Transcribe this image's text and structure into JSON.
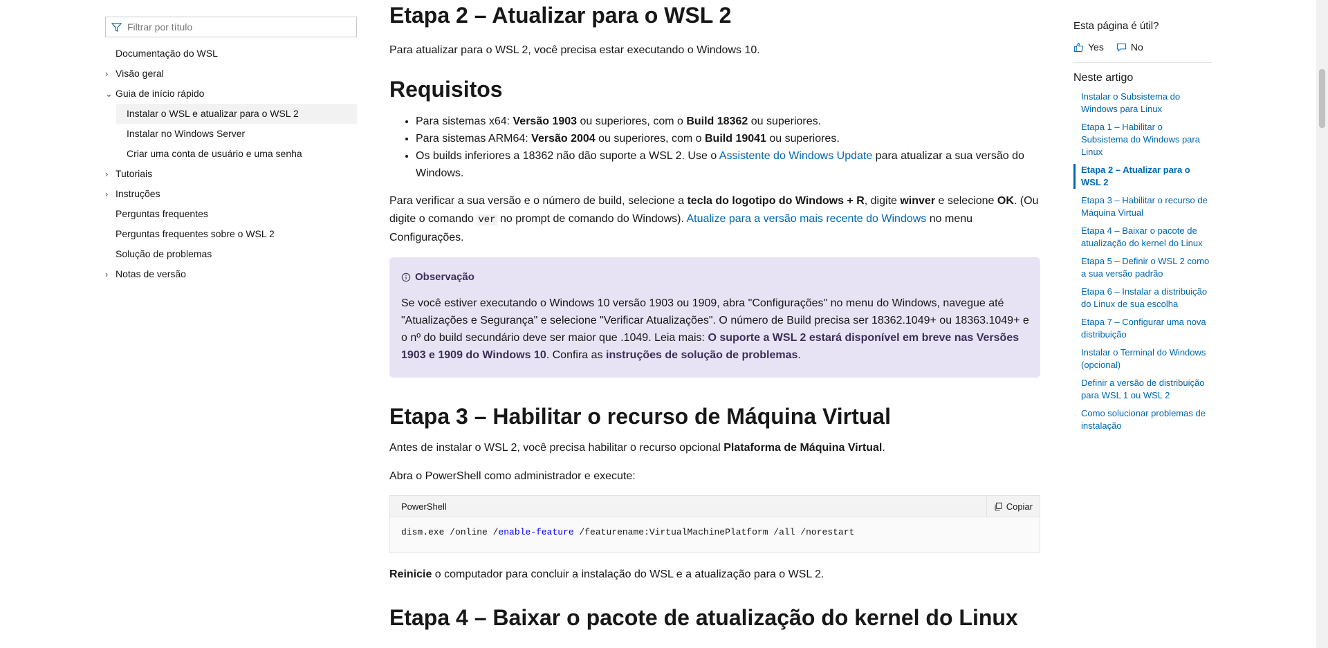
{
  "sidebar": {
    "filter_placeholder": "Filtrar por título",
    "items": [
      {
        "label": "Documentação do WSL",
        "chevron": ""
      },
      {
        "label": "Visão geral",
        "chevron": ">"
      },
      {
        "label": "Guia de início rápido",
        "chevron": "v"
      },
      {
        "label": "Instalar o WSL e atualizar para o WSL 2"
      },
      {
        "label": "Instalar no Windows Server"
      },
      {
        "label": "Criar uma conta de usuário e uma senha"
      },
      {
        "label": "Tutoriais",
        "chevron": ">"
      },
      {
        "label": "Instruções",
        "chevron": ">"
      },
      {
        "label": "Perguntas frequentes",
        "chevron": ""
      },
      {
        "label": "Perguntas frequentes sobre o WSL 2",
        "chevron": ""
      },
      {
        "label": "Solução de problemas",
        "chevron": ""
      },
      {
        "label": "Notas de versão",
        "chevron": ">"
      }
    ]
  },
  "main": {
    "step2_title": "Etapa 2 – Atualizar para o WSL 2",
    "step2_intro": "Para atualizar para o WSL 2, você precisa estar executando o Windows 10.",
    "req_title": "Requisitos",
    "req": {
      "x64_a": "Para sistemas x64: ",
      "x64_b": "Versão 1903",
      "x64_c": " ou superiores, com o ",
      "x64_d": "Build 18362",
      "x64_e": " ou superiores.",
      "arm_a": "Para sistemas ARM64: ",
      "arm_b": "Versão 2004",
      "arm_c": " ou superiores, com o ",
      "arm_d": "Build 19041",
      "arm_e": " ou superiores.",
      "builds_a": "Os builds inferiores a 18362 não dão suporte a WSL 2. Use o ",
      "builds_link": "Assistente do Windows Update",
      "builds_b": " para atualizar a sua versão do Windows."
    },
    "verify": {
      "a": "Para verificar a sua versão e o número de build, selecione a ",
      "b": "tecla do logotipo do Windows + R",
      "c": ", digite ",
      "d": "winver",
      "e": " e selecione ",
      "f": "OK",
      "g": ". (Ou digite o comando ",
      "code": "ver",
      "h": " no prompt de comando do Windows). ",
      "link": "Atualize para a versão mais recente do Windows",
      "i": " no menu Configurações."
    },
    "note": {
      "title": "Observação",
      "a": "Se você estiver executando o Windows 10 versão 1903 ou 1909, abra \"Configurações\" no menu do Windows, navegue até \"Atualizações e Segurança\" e selecione \"Verificar Atualizações\". O número de Build precisa ser 18362.1049+ ou 18363.1049+ e o nº do build secundário deve ser maior que .1049. Leia mais: ",
      "link1": "O suporte a WSL 2 estará disponível em breve nas Versões 1903 e 1909 do Windows 10",
      "b": ". Confira as ",
      "link2": "instruções de solução de problemas",
      "c": "."
    },
    "step3_title": "Etapa 3 – Habilitar o recurso de Máquina Virtual",
    "step3_intro_a": "Antes de instalar o WSL 2, você precisa habilitar o recurso opcional ",
    "step3_intro_b": "Plataforma de Máquina Virtual",
    "step3_intro_c": ".",
    "powershell_line": "Abra o PowerShell como administrador e execute:",
    "code": {
      "lang": "PowerShell",
      "copy_label": "Copiar",
      "part1": "dism.exe /online /",
      "part2": "enable-feature",
      "part3": " /featurename:VirtualMachinePlatform /all /norestart"
    },
    "restart_a": "Reinicie",
    "restart_b": " o computador para concluir a instalação do WSL e a atualização para o WSL 2.",
    "step4_title": "Etapa 4 – Baixar o pacote de atualização do kernel do Linux"
  },
  "right": {
    "useful_title": "Esta página é útil?",
    "yes": "Yes",
    "no": "No",
    "toc_title": "Neste artigo",
    "toc": [
      "Instalar o Subsistema do Windows para Linux",
      "Etapa 1 – Habilitar o Subsistema do Windows para Linux",
      "Etapa 2 – Atualizar para o WSL 2",
      "Etapa 3 – Habilitar o recurso de Máquina Virtual",
      "Etapa 4 – Baixar o pacote de atualização do kernel do Linux",
      "Etapa 5 – Definir o WSL 2 como a sua versão padrão",
      "Etapa 6 – Instalar a distribuição do Linux de sua escolha",
      "Etapa 7 – Configurar uma nova distribuição",
      "Instalar o Terminal do Windows (opcional)",
      "Definir a versão de distribuição para WSL 1 ou WSL 2",
      "Como solucionar problemas de instalação"
    ]
  },
  "colors": {
    "link": "#0065b3",
    "note_bg": "#e8e3f4",
    "note_text": "#3b2e58",
    "active_nav_bg": "#f2f2f2"
  }
}
